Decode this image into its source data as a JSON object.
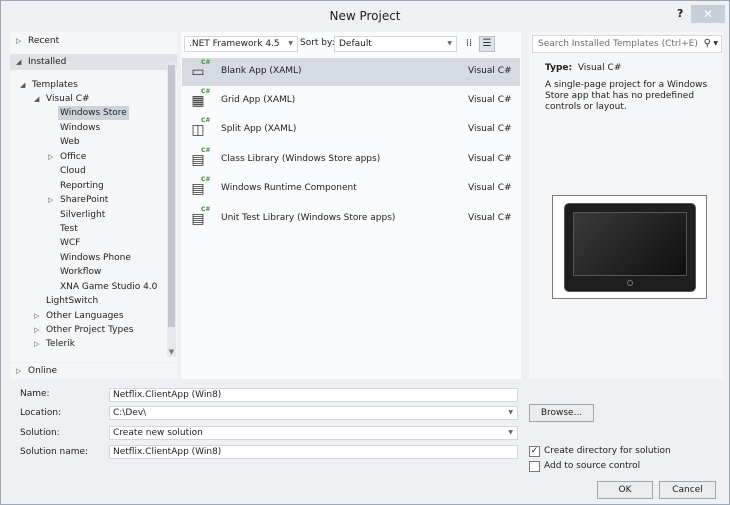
{
  "window": {
    "title": "New Project",
    "help_label": "?",
    "close_label": "✕"
  },
  "nav": {
    "recent": "Recent",
    "installed": "Installed",
    "templates": "Templates",
    "visual_csharp": "Visual C#",
    "items": [
      "Windows Store",
      "Windows",
      "Web",
      "Office",
      "Cloud",
      "Reporting",
      "SharePoint",
      "Silverlight",
      "Test",
      "WCF",
      "Windows Phone",
      "Workflow",
      "XNA Game Studio 4.0"
    ],
    "lightswitch": "LightSwitch",
    "other_languages": "Other Languages",
    "other_project_types": "Other Project Types",
    "telerik": "Telerik",
    "online": "Online"
  },
  "toolbar": {
    "framework": ".NET Framework 4.5",
    "sort_label": "Sort by:",
    "sort_value": "Default"
  },
  "templates": [
    {
      "name": "Blank App (XAML)",
      "lang": "Visual C#",
      "icon": "blank-app-icon"
    },
    {
      "name": "Grid App (XAML)",
      "lang": "Visual C#",
      "icon": "grid-app-icon"
    },
    {
      "name": "Split App (XAML)",
      "lang": "Visual C#",
      "icon": "split-app-icon"
    },
    {
      "name": "Class Library (Windows Store apps)",
      "lang": "Visual C#",
      "icon": "class-library-icon"
    },
    {
      "name": "Windows Runtime Component",
      "lang": "Visual C#",
      "icon": "runtime-component-icon"
    },
    {
      "name": "Unit Test Library (Windows Store apps)",
      "lang": "Visual C#",
      "icon": "unit-test-icon"
    }
  ],
  "search": {
    "placeholder": "Search Installed Templates (Ctrl+E)"
  },
  "details": {
    "type_label": "Type:",
    "type_value": "Visual C#",
    "description": "A single-page project for a Windows Store app that has no predefined controls or layout."
  },
  "form": {
    "name_label": "Name:",
    "name_value": "Netflix.ClientApp (Win8)",
    "location_label": "Location:",
    "location_value": "C:\\Dev\\",
    "solution_label": "Solution:",
    "solution_value": "Create new solution",
    "solution_name_label": "Solution name:",
    "solution_name_value": "Netflix.ClientApp (Win8)",
    "browse": "Browse...",
    "create_directory": "Create directory for solution",
    "create_directory_checked": true,
    "add_source_control": "Add to source control",
    "add_source_control_checked": false,
    "ok": "OK",
    "cancel": "Cancel"
  }
}
